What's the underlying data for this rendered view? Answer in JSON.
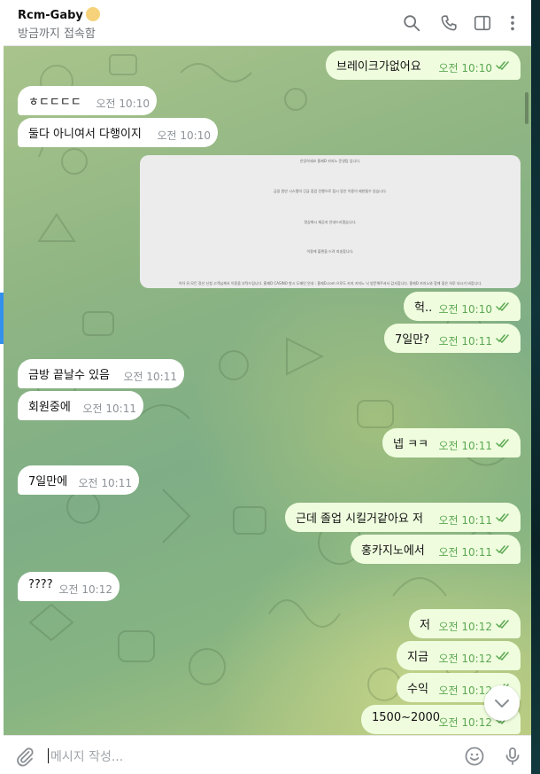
{
  "header": {
    "title": "Rcm-Gaby",
    "status": "방금까지 접속함",
    "icons": [
      "search-icon",
      "phone-icon",
      "sidebar-icon",
      "more-icon"
    ]
  },
  "messages": [
    {
      "dir": "out",
      "text": "브레이크가없어요",
      "time": "오전 10:10"
    },
    {
      "dir": "in",
      "text": "ㅎㄷㄷㄷㄷ",
      "time": "오전 10:10"
    },
    {
      "dir": "in",
      "text": "둘다 아니여서 다행이지",
      "time": "오전 10:10"
    },
    {
      "dir": "out",
      "text": "헉..",
      "time": "오전 10:10"
    },
    {
      "dir": "out",
      "text": "7일만?",
      "time": "오전 10:11"
    },
    {
      "dir": "in",
      "text": "금방 끝날수 있음",
      "time": "오전 10:11"
    },
    {
      "dir": "in",
      "text": "회원중에",
      "time": "오전 10:11"
    },
    {
      "dir": "out",
      "text": "넵 ㅋㅋ",
      "time": "오전 10:11"
    },
    {
      "dir": "in",
      "text": "7일만에",
      "time": "오전 10:11"
    },
    {
      "dir": "out",
      "text": "근데 졸업 시킬거같아요 저",
      "time": "오전 10:11"
    },
    {
      "dir": "out",
      "text": "홍카지노에서",
      "time": "오전 10:11"
    },
    {
      "dir": "in",
      "text": "????",
      "time": "오전 10:12"
    },
    {
      "dir": "out",
      "text": "저",
      "time": "오전 10:12"
    },
    {
      "dir": "out",
      "text": "지금",
      "time": "오전 10:12"
    },
    {
      "dir": "out",
      "text": "수익",
      "time": "오전 10:12"
    },
    {
      "dir": "out",
      "text": "1500~2000",
      "time": "오전 10:12"
    }
  ],
  "image_message": {
    "lines": [
      "안녕하세요 홍제D 카지노 운영팀 입니다.",
      "금일 원만 시스템의 긴급 점검 진행으로 잠시 동안 이용이 제한될수 있습니다.",
      "정상화시 재공지 안내드리겠습니다.",
      "이용에 불편을 드려 죄송합니다.",
      "이하 뒤 모든 정산 신청 고객님께서 이용을 부탁드립니다. 홍제D CASINO 항시 도메인 안내 : 홍제D.com 으로도 카지 카지노 닉 방문해주셔서 감사합니다. 홍제D 카지노와 함께 좋은 하루 되시기 바랍니다."
    ]
  },
  "composer": {
    "placeholder": "메시지 작성...",
    "icons": [
      "attach-icon",
      "emoji-icon",
      "microphone-icon"
    ]
  },
  "colors": {
    "incoming_bubble": "#ffffff",
    "outgoing_bubble": "#effdde",
    "outgoing_time": "#5ca853",
    "incoming_time": "#8d9399",
    "header_icon": "#707579"
  }
}
